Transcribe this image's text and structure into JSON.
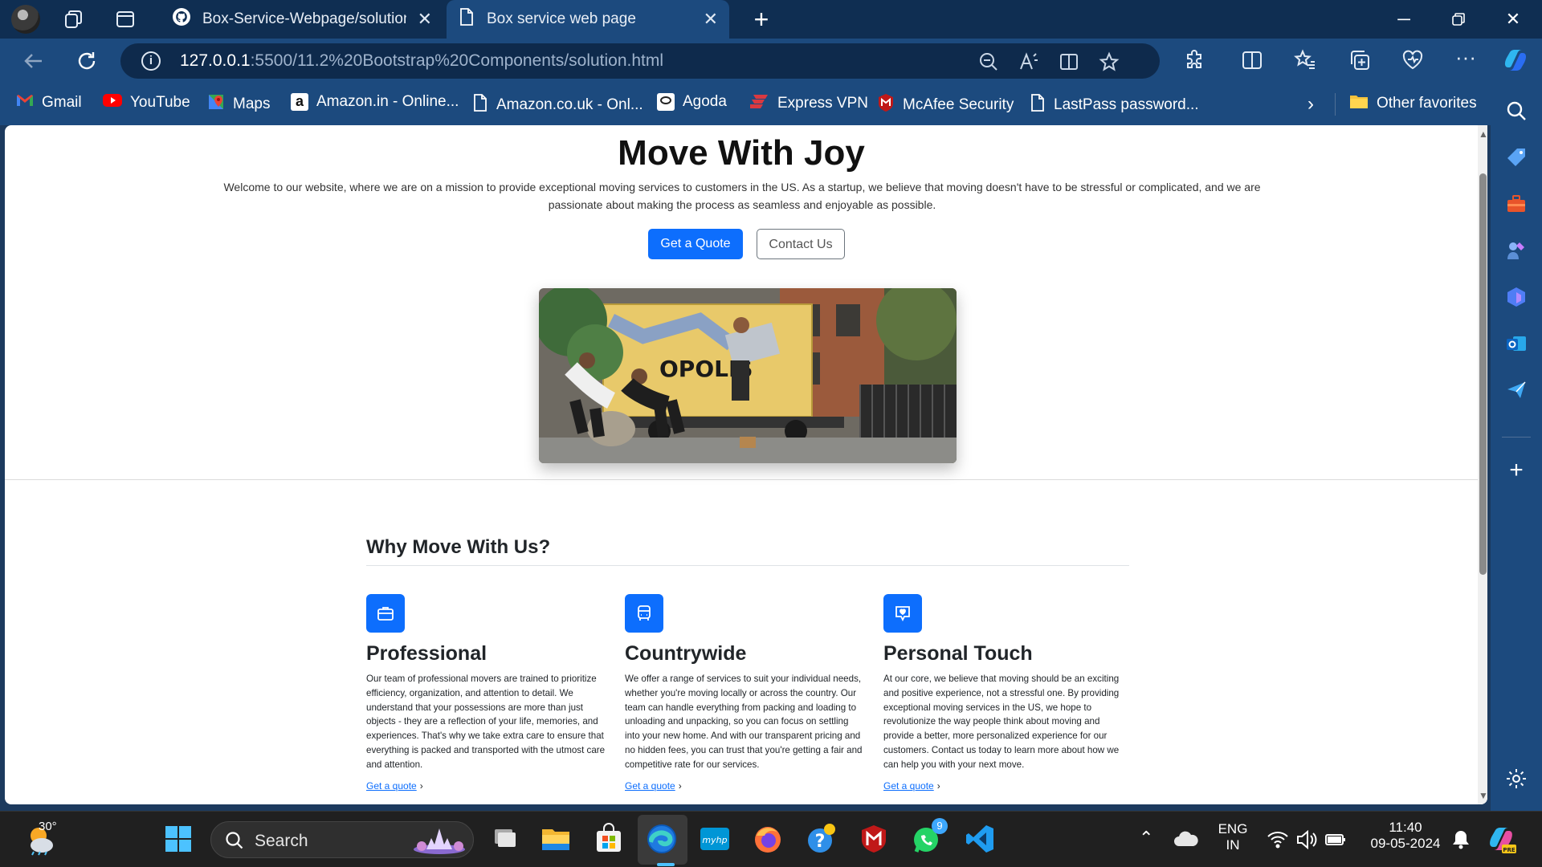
{
  "browser": {
    "tabs": [
      {
        "title": "Box-Service-Webpage/solution.h",
        "active": false
      },
      {
        "title": "Box service web page",
        "active": true
      }
    ],
    "url_host": "127.0.0.1",
    "url_path": ":5500/11.2%20Bootstrap%20Components/solution.html",
    "favorites": [
      "Gmail",
      "YouTube",
      "Maps",
      "Amazon.in - Online...",
      "Amazon.co.uk - Onl...",
      "Agoda",
      "Express VPN",
      "McAfee Security",
      "LastPass password..."
    ],
    "other_favorites": "Other favorites",
    "accent": "#1c4a7e"
  },
  "hero": {
    "title": "Move With Joy",
    "lead": "Welcome to our website, where we are on a mission to provide exceptional moving services to customers in the US. As a startup, we believe that moving doesn't have to be stressful or complicated, and we are passionate about making the process as seamless and enjoyable as possible.",
    "primary_button": "Get a Quote",
    "secondary_button": "Contact Us",
    "primary_color": "#0d6efd"
  },
  "features": {
    "heading": "Why Move With Us?",
    "items": [
      {
        "icon": "briefcase-icon",
        "title": "Professional",
        "text": "Our team of professional movers are trained to prioritize efficiency, organization, and attention to detail. We understand that your possessions are more than just objects - they are a reflection of your life, memories, and experiences. That's why we take extra care to ensure that everything is packed and transported with the utmost care and attention.",
        "link": "Get a quote"
      },
      {
        "icon": "truck-icon",
        "title": "Countrywide",
        "text": "We offer a range of services to suit your individual needs, whether you're moving locally or across the country. Our team can handle everything from packing and loading to unloading and unpacking, so you can focus on settling into your new home. And with our transparent pricing and no hidden fees, you can trust that you're getting a fair and competitive rate for our services.",
        "link": "Get a quote"
      },
      {
        "icon": "chat-heart-icon",
        "title": "Personal Touch",
        "text": "At our core, we believe that moving should be an exciting and positive experience, not a stressful one. By providing exceptional moving services in the US, we hope to revolutionize the way people think about moving and provide a better, more personalized experience for our customers. Contact us today to learn more about how we can help you with your next move.",
        "link": "Get a quote"
      }
    ]
  },
  "taskbar": {
    "weather_temp": "30°",
    "search_placeholder": "Search",
    "whatsapp_badge": "9",
    "lang_line1": "ENG",
    "lang_line2": "IN",
    "time": "11:40",
    "date": "09-05-2024"
  }
}
